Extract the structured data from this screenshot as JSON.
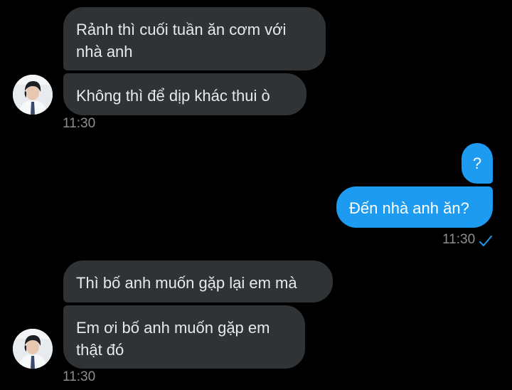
{
  "incoming_group_1": {
    "messages": [
      "Rảnh thì cuối tuần ăn cơm với\nnhà anh",
      "Không thì để dịp khác thui ò"
    ],
    "time": "11:30"
  },
  "outgoing_group": {
    "messages": [
      "?",
      "Đến nhà anh ăn?"
    ],
    "time": "11:30",
    "status": "read"
  },
  "incoming_group_2": {
    "messages": [
      "Thì bố anh muốn gặp lại em mà",
      "Em ơi bố anh muốn gặp em\nthật đó"
    ],
    "time": "11:30"
  },
  "colors": {
    "background": "#000000",
    "incoming_bubble": "#2f3336",
    "outgoing_bubble": "#1d9bf0",
    "text": "#e7e9ea",
    "timestamp": "#8b8f94",
    "read_check": "#1d9bf0"
  },
  "icons": {
    "avatar": "contact-avatar",
    "read_receipt": "checkmark-icon"
  }
}
